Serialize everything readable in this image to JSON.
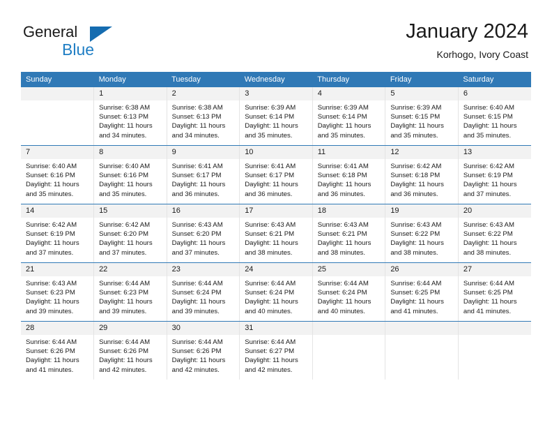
{
  "logo": {
    "word1": "General",
    "word2": "Blue",
    "triangle_color": "#156cb0",
    "blue_color": "#1f7ec4"
  },
  "header": {
    "title": "January 2024",
    "location": "Korhogo, Ivory Coast"
  },
  "theme": {
    "header_bg": "#3079b6",
    "daynum_bg": "#f2f2f2",
    "grid_line": "#e4e4e4"
  },
  "weekdays": [
    "Sunday",
    "Monday",
    "Tuesday",
    "Wednesday",
    "Thursday",
    "Friday",
    "Saturday"
  ],
  "weeks": [
    [
      {
        "day": "",
        "lines": []
      },
      {
        "day": "1",
        "lines": [
          "Sunrise: 6:38 AM",
          "Sunset: 6:13 PM",
          "Daylight: 11 hours",
          "and 34 minutes."
        ]
      },
      {
        "day": "2",
        "lines": [
          "Sunrise: 6:38 AM",
          "Sunset: 6:13 PM",
          "Daylight: 11 hours",
          "and 34 minutes."
        ]
      },
      {
        "day": "3",
        "lines": [
          "Sunrise: 6:39 AM",
          "Sunset: 6:14 PM",
          "Daylight: 11 hours",
          "and 35 minutes."
        ]
      },
      {
        "day": "4",
        "lines": [
          "Sunrise: 6:39 AM",
          "Sunset: 6:14 PM",
          "Daylight: 11 hours",
          "and 35 minutes."
        ]
      },
      {
        "day": "5",
        "lines": [
          "Sunrise: 6:39 AM",
          "Sunset: 6:15 PM",
          "Daylight: 11 hours",
          "and 35 minutes."
        ]
      },
      {
        "day": "6",
        "lines": [
          "Sunrise: 6:40 AM",
          "Sunset: 6:15 PM",
          "Daylight: 11 hours",
          "and 35 minutes."
        ]
      }
    ],
    [
      {
        "day": "7",
        "lines": [
          "Sunrise: 6:40 AM",
          "Sunset: 6:16 PM",
          "Daylight: 11 hours",
          "and 35 minutes."
        ]
      },
      {
        "day": "8",
        "lines": [
          "Sunrise: 6:40 AM",
          "Sunset: 6:16 PM",
          "Daylight: 11 hours",
          "and 35 minutes."
        ]
      },
      {
        "day": "9",
        "lines": [
          "Sunrise: 6:41 AM",
          "Sunset: 6:17 PM",
          "Daylight: 11 hours",
          "and 36 minutes."
        ]
      },
      {
        "day": "10",
        "lines": [
          "Sunrise: 6:41 AM",
          "Sunset: 6:17 PM",
          "Daylight: 11 hours",
          "and 36 minutes."
        ]
      },
      {
        "day": "11",
        "lines": [
          "Sunrise: 6:41 AM",
          "Sunset: 6:18 PM",
          "Daylight: 11 hours",
          "and 36 minutes."
        ]
      },
      {
        "day": "12",
        "lines": [
          "Sunrise: 6:42 AM",
          "Sunset: 6:18 PM",
          "Daylight: 11 hours",
          "and 36 minutes."
        ]
      },
      {
        "day": "13",
        "lines": [
          "Sunrise: 6:42 AM",
          "Sunset: 6:19 PM",
          "Daylight: 11 hours",
          "and 37 minutes."
        ]
      }
    ],
    [
      {
        "day": "14",
        "lines": [
          "Sunrise: 6:42 AM",
          "Sunset: 6:19 PM",
          "Daylight: 11 hours",
          "and 37 minutes."
        ]
      },
      {
        "day": "15",
        "lines": [
          "Sunrise: 6:42 AM",
          "Sunset: 6:20 PM",
          "Daylight: 11 hours",
          "and 37 minutes."
        ]
      },
      {
        "day": "16",
        "lines": [
          "Sunrise: 6:43 AM",
          "Sunset: 6:20 PM",
          "Daylight: 11 hours",
          "and 37 minutes."
        ]
      },
      {
        "day": "17",
        "lines": [
          "Sunrise: 6:43 AM",
          "Sunset: 6:21 PM",
          "Daylight: 11 hours",
          "and 38 minutes."
        ]
      },
      {
        "day": "18",
        "lines": [
          "Sunrise: 6:43 AM",
          "Sunset: 6:21 PM",
          "Daylight: 11 hours",
          "and 38 minutes."
        ]
      },
      {
        "day": "19",
        "lines": [
          "Sunrise: 6:43 AM",
          "Sunset: 6:22 PM",
          "Daylight: 11 hours",
          "and 38 minutes."
        ]
      },
      {
        "day": "20",
        "lines": [
          "Sunrise: 6:43 AM",
          "Sunset: 6:22 PM",
          "Daylight: 11 hours",
          "and 38 minutes."
        ]
      }
    ],
    [
      {
        "day": "21",
        "lines": [
          "Sunrise: 6:43 AM",
          "Sunset: 6:23 PM",
          "Daylight: 11 hours",
          "and 39 minutes."
        ]
      },
      {
        "day": "22",
        "lines": [
          "Sunrise: 6:44 AM",
          "Sunset: 6:23 PM",
          "Daylight: 11 hours",
          "and 39 minutes."
        ]
      },
      {
        "day": "23",
        "lines": [
          "Sunrise: 6:44 AM",
          "Sunset: 6:24 PM",
          "Daylight: 11 hours",
          "and 39 minutes."
        ]
      },
      {
        "day": "24",
        "lines": [
          "Sunrise: 6:44 AM",
          "Sunset: 6:24 PM",
          "Daylight: 11 hours",
          "and 40 minutes."
        ]
      },
      {
        "day": "25",
        "lines": [
          "Sunrise: 6:44 AM",
          "Sunset: 6:24 PM",
          "Daylight: 11 hours",
          "and 40 minutes."
        ]
      },
      {
        "day": "26",
        "lines": [
          "Sunrise: 6:44 AM",
          "Sunset: 6:25 PM",
          "Daylight: 11 hours",
          "and 41 minutes."
        ]
      },
      {
        "day": "27",
        "lines": [
          "Sunrise: 6:44 AM",
          "Sunset: 6:25 PM",
          "Daylight: 11 hours",
          "and 41 minutes."
        ]
      }
    ],
    [
      {
        "day": "28",
        "lines": [
          "Sunrise: 6:44 AM",
          "Sunset: 6:26 PM",
          "Daylight: 11 hours",
          "and 41 minutes."
        ]
      },
      {
        "day": "29",
        "lines": [
          "Sunrise: 6:44 AM",
          "Sunset: 6:26 PM",
          "Daylight: 11 hours",
          "and 42 minutes."
        ]
      },
      {
        "day": "30",
        "lines": [
          "Sunrise: 6:44 AM",
          "Sunset: 6:26 PM",
          "Daylight: 11 hours",
          "and 42 minutes."
        ]
      },
      {
        "day": "31",
        "lines": [
          "Sunrise: 6:44 AM",
          "Sunset: 6:27 PM",
          "Daylight: 11 hours",
          "and 42 minutes."
        ]
      },
      {
        "day": "",
        "lines": []
      },
      {
        "day": "",
        "lines": []
      },
      {
        "day": "",
        "lines": []
      }
    ]
  ]
}
